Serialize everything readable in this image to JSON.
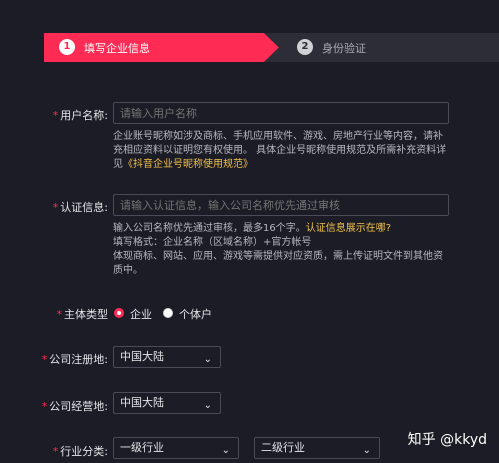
{
  "steps": [
    {
      "num": "1",
      "label": "填写企业信息"
    },
    {
      "num": "2",
      "label": "身份验证"
    }
  ],
  "form": {
    "username": {
      "label": "用户名称:",
      "placeholder": "请输入用户名称",
      "help_1": "企业账号昵称如涉及商标、手机应用软件、游戏、房地产行业等内容，请补",
      "help_2": "充相应资料以证明您有权使用。 具体企业号昵称使用规范及所需补充资料详",
      "help_3_prefix": "见",
      "help_3_link": "《抖音企业号昵称使用规范》"
    },
    "certification": {
      "label": "认证信息:",
      "placeholder": "请输入认证信息，输入公司名称优先通过审核",
      "help_1_prefix": "输入公司名称优先通过审核，最多16个字。",
      "help_1_link": "认证信息展示在哪?",
      "help_2": "填写格式：企业名称（区域名称）+官方帐号",
      "help_3": "体现商标、网站、应用、游戏等需提供对应资质，需上传证明文件到其他资",
      "help_4": "质中。"
    },
    "entity_type": {
      "label": "主体类型",
      "options": [
        "企业",
        "个体户"
      ],
      "selected": "企业"
    },
    "registered_place": {
      "label": "公司注册地:",
      "value": "中国大陆"
    },
    "operating_place": {
      "label": "公司经营地:",
      "value": "中国大陆"
    },
    "industry": {
      "label": "行业分类:",
      "primary": "一级行业",
      "secondary": "二级行业"
    }
  },
  "watermark": "知乎 @kkyd",
  "colors": {
    "accent": "#fe2c55",
    "background": "#1b1c25",
    "link": "#f0c04a"
  }
}
